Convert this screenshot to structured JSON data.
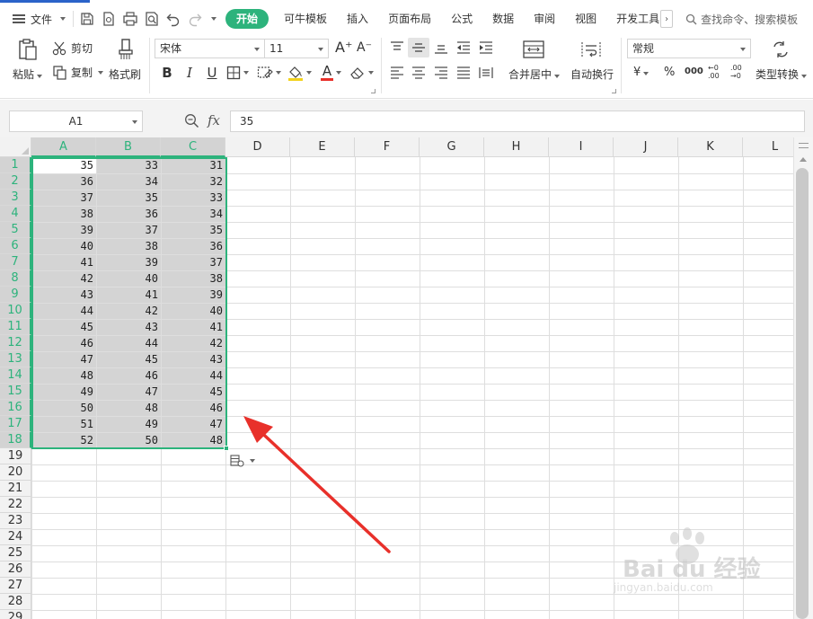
{
  "menubar": {
    "file_label": "文件",
    "tabs": [
      "开始",
      "可牛模板",
      "插入",
      "页面布局",
      "公式",
      "数据",
      "审阅",
      "视图",
      "开发工具"
    ],
    "active_tab": "开始",
    "search_placeholder": "查找命令、搜索模板"
  },
  "ribbon": {
    "paste_label": "粘贴",
    "cut_label": "剪切",
    "copy_label": "复制",
    "format_painter_label": "格式刷",
    "font_name": "宋体",
    "font_size": "11",
    "bold": "B",
    "italic": "I",
    "underline": "U",
    "font_color_letter": "A",
    "grow_font": "A⁺",
    "shrink_font": "A⁻",
    "merge_center_label": "合并居中",
    "wrap_text_label": "自动换行",
    "number_format": "常规",
    "currency_symbol": "¥",
    "percent_symbol": "%",
    "thousands_symbol": "000",
    "inc_decimal": "←0 .00",
    "dec_decimal": ".00 →0",
    "type_convert_label": "类型转换"
  },
  "formula_bar": {
    "name_box": "A1",
    "fx_label": "fx",
    "formula_value": "35"
  },
  "grid": {
    "columns": [
      "A",
      "B",
      "C",
      "D",
      "E",
      "F",
      "G",
      "H",
      "I",
      "J",
      "K",
      "L"
    ],
    "rows": [
      "1",
      "2",
      "3",
      "4",
      "5",
      "6",
      "7",
      "8",
      "9",
      "10",
      "11",
      "12",
      "13",
      "14",
      "15",
      "16",
      "17",
      "18",
      "19",
      "20",
      "21",
      "22",
      "23",
      "24",
      "25",
      "26",
      "27",
      "28",
      "29"
    ],
    "data": [
      [
        "35",
        "33",
        "31"
      ],
      [
        "36",
        "34",
        "32"
      ],
      [
        "37",
        "35",
        "33"
      ],
      [
        "38",
        "36",
        "34"
      ],
      [
        "39",
        "37",
        "35"
      ],
      [
        "40",
        "38",
        "36"
      ],
      [
        "41",
        "39",
        "37"
      ],
      [
        "42",
        "40",
        "38"
      ],
      [
        "43",
        "41",
        "39"
      ],
      [
        "44",
        "42",
        "40"
      ],
      [
        "45",
        "43",
        "41"
      ],
      [
        "46",
        "44",
        "42"
      ],
      [
        "47",
        "45",
        "43"
      ],
      [
        "48",
        "46",
        "44"
      ],
      [
        "49",
        "47",
        "45"
      ],
      [
        "50",
        "48",
        "46"
      ],
      [
        "51",
        "49",
        "47"
      ],
      [
        "52",
        "50",
        "48"
      ]
    ],
    "selection": "A1:C18",
    "accent_color": "#2db37c"
  },
  "annotation": {
    "arrow_color": "#e8302a"
  },
  "watermark": {
    "brand": "Bai du 经验",
    "url": "jingyan.baidu.com"
  }
}
